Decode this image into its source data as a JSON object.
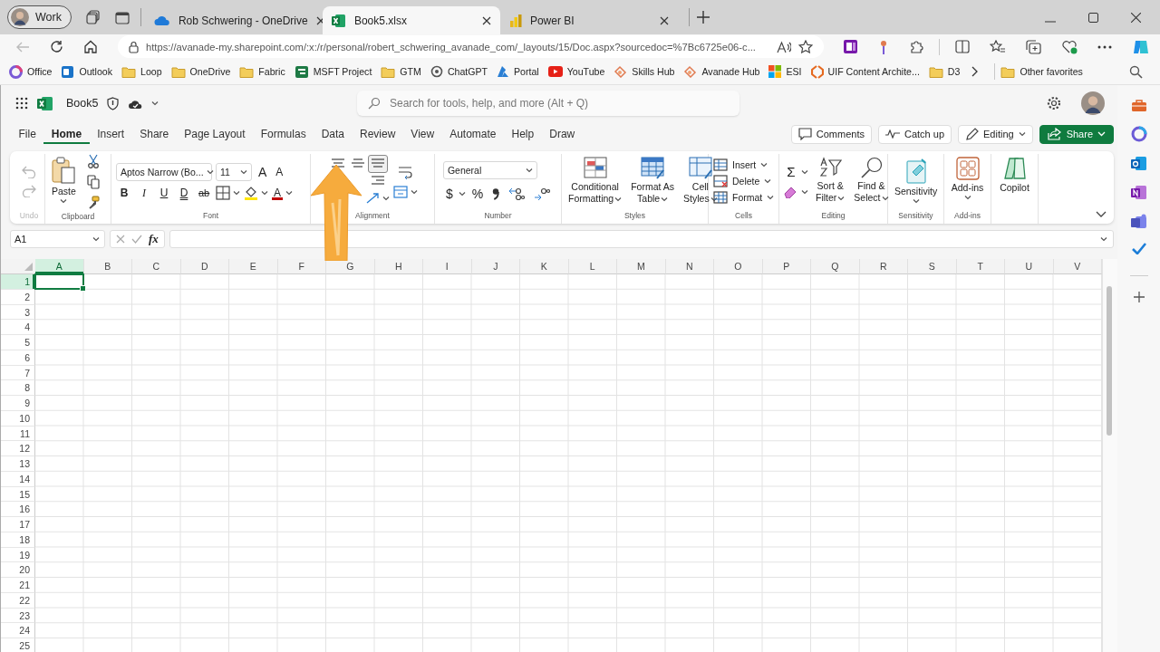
{
  "browser": {
    "profile": {
      "label": "Work"
    },
    "tabs": [
      {
        "title": "Rob Schwering - OneDrive",
        "kind": "onedrive",
        "selected": false
      },
      {
        "title": "Book5.xlsx",
        "kind": "excel",
        "selected": true
      },
      {
        "title": "Power BI",
        "kind": "powerbi",
        "selected": false
      }
    ],
    "address": "https://avanade-my.sharepoint.com/:x:/r/personal/robert_schwering_avanade_com/_layouts/15/Doc.aspx?sourcedoc=%7Bc6725e06-c...",
    "bookmarks": [
      {
        "label": "Office",
        "kind": "office"
      },
      {
        "label": "Outlook",
        "kind": "outlook"
      },
      {
        "label": "Loop",
        "kind": "folder"
      },
      {
        "label": "OneDrive",
        "kind": "folder"
      },
      {
        "label": "Fabric",
        "kind": "folder"
      },
      {
        "label": "MSFT Project",
        "kind": "project"
      },
      {
        "label": "GTM",
        "kind": "folder"
      },
      {
        "label": "ChatGPT",
        "kind": "chatgpt"
      },
      {
        "label": "Portal",
        "kind": "azure"
      },
      {
        "label": "YouTube",
        "kind": "youtube"
      },
      {
        "label": "Skills Hub",
        "kind": "hub"
      },
      {
        "label": "Avanade Hub",
        "kind": "hub"
      },
      {
        "label": "ESI",
        "kind": "windows"
      },
      {
        "label": "UIF Content Archite...",
        "kind": "uif"
      },
      {
        "label": "D3",
        "kind": "folder"
      }
    ],
    "other_favorites": "Other favorites"
  },
  "app": {
    "file_name": "Book5",
    "search_placeholder": "Search for tools, help, and more (Alt + Q)"
  },
  "menu_tabs": [
    {
      "label": "File",
      "selected": false
    },
    {
      "label": "Home",
      "selected": true
    },
    {
      "label": "Insert",
      "selected": false
    },
    {
      "label": "Share",
      "selected": false
    },
    {
      "label": "Page Layout",
      "selected": false
    },
    {
      "label": "Formulas",
      "selected": false
    },
    {
      "label": "Data",
      "selected": false
    },
    {
      "label": "Review",
      "selected": false
    },
    {
      "label": "View",
      "selected": false
    },
    {
      "label": "Automate",
      "selected": false
    },
    {
      "label": "Help",
      "selected": false
    },
    {
      "label": "Draw",
      "selected": false
    }
  ],
  "actions": [
    {
      "label": "Comments",
      "kind": "comments"
    },
    {
      "label": "Catch up",
      "kind": "catchup"
    },
    {
      "label": "Editing",
      "kind": "editing"
    },
    {
      "label": "Share",
      "kind": "share"
    }
  ],
  "ribbon": [
    {
      "kind": "undo",
      "label": "Undo",
      "disabled": true
    },
    {
      "kind": "clipboard",
      "label": "Clipboard",
      "paste": "Paste"
    },
    {
      "kind": "font",
      "label": "Font",
      "font_name": "Aptos Narrow (Bo...",
      "font_size": "11",
      "grow": "A",
      "shrink": "A",
      "styles": [
        "B",
        "I",
        "U",
        "D",
        "ab"
      ],
      "font_color": "A"
    },
    {
      "kind": "alignment",
      "label": "Alignment"
    },
    {
      "kind": "number",
      "label": "Number",
      "format": "General",
      "currency": "$",
      "percent": "%"
    },
    {
      "kind": "styles",
      "label": "Styles",
      "commands": [
        {
          "lines": [
            "Conditional",
            "Formatting"
          ]
        },
        {
          "lines": [
            "Format As",
            "Table"
          ]
        },
        {
          "lines": [
            "Cell",
            "Styles"
          ]
        }
      ]
    },
    {
      "kind": "cells",
      "label": "Cells",
      "commands": [
        "Insert",
        "Delete",
        "Format"
      ]
    },
    {
      "kind": "editing",
      "label": "Editing",
      "sum": "Σ",
      "commands": [
        {
          "lines": [
            "Sort &",
            "Filter"
          ]
        },
        {
          "lines": [
            "Find &",
            "Select"
          ]
        }
      ]
    },
    {
      "kind": "sensitivity",
      "label": "Sensitivity",
      "command": "Sensitivity"
    },
    {
      "kind": "addins",
      "label": "Add-ins",
      "command": "Add-ins"
    },
    {
      "kind": "copilot",
      "command": "Copilot"
    }
  ],
  "formula_bar": {
    "name_box": "A1",
    "function_label": "fx"
  },
  "sheet": {
    "columns": [
      {
        "label": "A",
        "selected": true
      },
      {
        "label": "B",
        "selected": false
      },
      {
        "label": "C",
        "selected": false
      },
      {
        "label": "D",
        "selected": false
      },
      {
        "label": "E",
        "selected": false
      },
      {
        "label": "F",
        "selected": false
      },
      {
        "label": "G",
        "selected": false
      },
      {
        "label": "H",
        "selected": false
      },
      {
        "label": "I",
        "selected": false
      },
      {
        "label": "J",
        "selected": false
      },
      {
        "label": "K",
        "selected": false
      },
      {
        "label": "L",
        "selected": false
      },
      {
        "label": "M",
        "selected": false
      },
      {
        "label": "N",
        "selected": false
      },
      {
        "label": "O",
        "selected": false
      },
      {
        "label": "P",
        "selected": false
      },
      {
        "label": "Q",
        "selected": false
      },
      {
        "label": "R",
        "selected": false
      },
      {
        "label": "S",
        "selected": false
      },
      {
        "label": "T",
        "selected": false
      },
      {
        "label": "U",
        "selected": false
      },
      {
        "label": "V",
        "selected": false
      }
    ],
    "rows": [
      {
        "label": "1",
        "selected": true
      },
      {
        "label": "2",
        "selected": false
      },
      {
        "label": "3",
        "selected": false
      },
      {
        "label": "4",
        "selected": false
      },
      {
        "label": "5",
        "selected": false
      },
      {
        "label": "6",
        "selected": false
      },
      {
        "label": "7",
        "selected": false
      },
      {
        "label": "8",
        "selected": false
      },
      {
        "label": "9",
        "selected": false
      },
      {
        "label": "10",
        "selected": false
      },
      {
        "label": "11",
        "selected": false
      },
      {
        "label": "12",
        "selected": false
      },
      {
        "label": "13",
        "selected": false
      },
      {
        "label": "14",
        "selected": false
      },
      {
        "label": "15",
        "selected": false
      },
      {
        "label": "16",
        "selected": false
      },
      {
        "label": "17",
        "selected": false
      },
      {
        "label": "18",
        "selected": false
      },
      {
        "label": "19",
        "selected": false
      },
      {
        "label": "20",
        "selected": false
      },
      {
        "label": "21",
        "selected": false
      },
      {
        "label": "22",
        "selected": false
      },
      {
        "label": "23",
        "selected": false
      },
      {
        "label": "24",
        "selected": false
      },
      {
        "label": "25",
        "selected": false
      }
    ]
  }
}
